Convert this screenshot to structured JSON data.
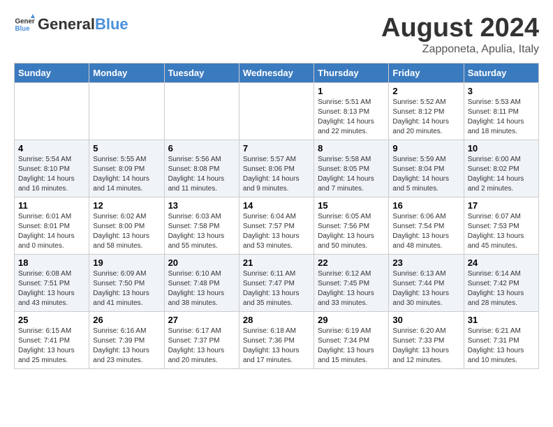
{
  "logo": {
    "line1": "General",
    "line2": "Blue"
  },
  "title": "August 2024",
  "subtitle": "Zapponeta, Apulia, Italy",
  "days_of_week": [
    "Sunday",
    "Monday",
    "Tuesday",
    "Wednesday",
    "Thursday",
    "Friday",
    "Saturday"
  ],
  "weeks": [
    [
      {
        "day": "",
        "info": ""
      },
      {
        "day": "",
        "info": ""
      },
      {
        "day": "",
        "info": ""
      },
      {
        "day": "",
        "info": ""
      },
      {
        "day": "1",
        "info": "Sunrise: 5:51 AM\nSunset: 8:13 PM\nDaylight: 14 hours\nand 22 minutes."
      },
      {
        "day": "2",
        "info": "Sunrise: 5:52 AM\nSunset: 8:12 PM\nDaylight: 14 hours\nand 20 minutes."
      },
      {
        "day": "3",
        "info": "Sunrise: 5:53 AM\nSunset: 8:11 PM\nDaylight: 14 hours\nand 18 minutes."
      }
    ],
    [
      {
        "day": "4",
        "info": "Sunrise: 5:54 AM\nSunset: 8:10 PM\nDaylight: 14 hours\nand 16 minutes."
      },
      {
        "day": "5",
        "info": "Sunrise: 5:55 AM\nSunset: 8:09 PM\nDaylight: 14 hours\nand 14 minutes."
      },
      {
        "day": "6",
        "info": "Sunrise: 5:56 AM\nSunset: 8:08 PM\nDaylight: 14 hours\nand 11 minutes."
      },
      {
        "day": "7",
        "info": "Sunrise: 5:57 AM\nSunset: 8:06 PM\nDaylight: 14 hours\nand 9 minutes."
      },
      {
        "day": "8",
        "info": "Sunrise: 5:58 AM\nSunset: 8:05 PM\nDaylight: 14 hours\nand 7 minutes."
      },
      {
        "day": "9",
        "info": "Sunrise: 5:59 AM\nSunset: 8:04 PM\nDaylight: 14 hours\nand 5 minutes."
      },
      {
        "day": "10",
        "info": "Sunrise: 6:00 AM\nSunset: 8:02 PM\nDaylight: 14 hours\nand 2 minutes."
      }
    ],
    [
      {
        "day": "11",
        "info": "Sunrise: 6:01 AM\nSunset: 8:01 PM\nDaylight: 14 hours\nand 0 minutes."
      },
      {
        "day": "12",
        "info": "Sunrise: 6:02 AM\nSunset: 8:00 PM\nDaylight: 13 hours\nand 58 minutes."
      },
      {
        "day": "13",
        "info": "Sunrise: 6:03 AM\nSunset: 7:58 PM\nDaylight: 13 hours\nand 55 minutes."
      },
      {
        "day": "14",
        "info": "Sunrise: 6:04 AM\nSunset: 7:57 PM\nDaylight: 13 hours\nand 53 minutes."
      },
      {
        "day": "15",
        "info": "Sunrise: 6:05 AM\nSunset: 7:56 PM\nDaylight: 13 hours\nand 50 minutes."
      },
      {
        "day": "16",
        "info": "Sunrise: 6:06 AM\nSunset: 7:54 PM\nDaylight: 13 hours\nand 48 minutes."
      },
      {
        "day": "17",
        "info": "Sunrise: 6:07 AM\nSunset: 7:53 PM\nDaylight: 13 hours\nand 45 minutes."
      }
    ],
    [
      {
        "day": "18",
        "info": "Sunrise: 6:08 AM\nSunset: 7:51 PM\nDaylight: 13 hours\nand 43 minutes."
      },
      {
        "day": "19",
        "info": "Sunrise: 6:09 AM\nSunset: 7:50 PM\nDaylight: 13 hours\nand 41 minutes."
      },
      {
        "day": "20",
        "info": "Sunrise: 6:10 AM\nSunset: 7:48 PM\nDaylight: 13 hours\nand 38 minutes."
      },
      {
        "day": "21",
        "info": "Sunrise: 6:11 AM\nSunset: 7:47 PM\nDaylight: 13 hours\nand 35 minutes."
      },
      {
        "day": "22",
        "info": "Sunrise: 6:12 AM\nSunset: 7:45 PM\nDaylight: 13 hours\nand 33 minutes."
      },
      {
        "day": "23",
        "info": "Sunrise: 6:13 AM\nSunset: 7:44 PM\nDaylight: 13 hours\nand 30 minutes."
      },
      {
        "day": "24",
        "info": "Sunrise: 6:14 AM\nSunset: 7:42 PM\nDaylight: 13 hours\nand 28 minutes."
      }
    ],
    [
      {
        "day": "25",
        "info": "Sunrise: 6:15 AM\nSunset: 7:41 PM\nDaylight: 13 hours\nand 25 minutes."
      },
      {
        "day": "26",
        "info": "Sunrise: 6:16 AM\nSunset: 7:39 PM\nDaylight: 13 hours\nand 23 minutes."
      },
      {
        "day": "27",
        "info": "Sunrise: 6:17 AM\nSunset: 7:37 PM\nDaylight: 13 hours\nand 20 minutes."
      },
      {
        "day": "28",
        "info": "Sunrise: 6:18 AM\nSunset: 7:36 PM\nDaylight: 13 hours\nand 17 minutes."
      },
      {
        "day": "29",
        "info": "Sunrise: 6:19 AM\nSunset: 7:34 PM\nDaylight: 13 hours\nand 15 minutes."
      },
      {
        "day": "30",
        "info": "Sunrise: 6:20 AM\nSunset: 7:33 PM\nDaylight: 13 hours\nand 12 minutes."
      },
      {
        "day": "31",
        "info": "Sunrise: 6:21 AM\nSunset: 7:31 PM\nDaylight: 13 hours\nand 10 minutes."
      }
    ]
  ]
}
